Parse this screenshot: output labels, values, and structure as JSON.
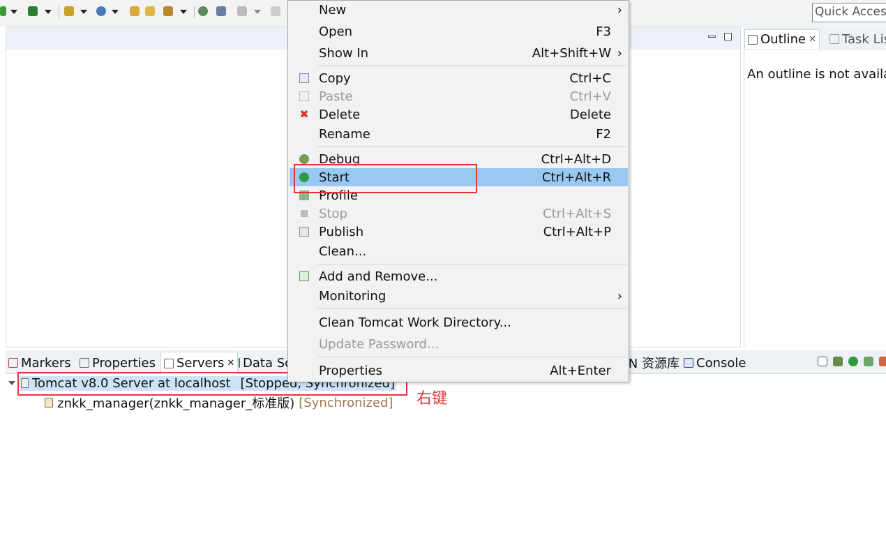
{
  "toolbar": {
    "quick_access": "Quick Access"
  },
  "outline": {
    "tab_outline": "Outline",
    "tab_tasks": "Task List",
    "message": "An outline is not available."
  },
  "bottom_tabs": {
    "markers": "Markers",
    "properties": "Properties",
    "servers": "Servers",
    "data_source": "Data Source Explorer",
    "svn": "SVN 资源库",
    "console": "Console"
  },
  "servers": {
    "server_name": "Tomcat v8.0 Server at localhost",
    "server_status": "[Stopped, Synchronized]",
    "module_name": "znkk_manager(znkk_manager_标准版)",
    "module_status": "[Synchronized]"
  },
  "annotation": {
    "text": "右键",
    "color": "#e5333a"
  },
  "menu": {
    "items": [
      {
        "label": "New",
        "shortcut": "",
        "submenu": true
      },
      {
        "label": "Open",
        "shortcut": "F3"
      },
      {
        "label": "Show In",
        "shortcut": "Alt+Shift+W",
        "submenu": true
      },
      {
        "label": "Copy",
        "shortcut": "Ctrl+C",
        "icon": "copy-icon"
      },
      {
        "label": "Paste",
        "shortcut": "Ctrl+V",
        "icon": "paste-icon",
        "disabled": true
      },
      {
        "label": "Delete",
        "shortcut": "Delete",
        "icon": "delete-icon"
      },
      {
        "label": "Rename",
        "shortcut": "F2"
      },
      {
        "label": "Debug",
        "shortcut": "Ctrl+Alt+D",
        "icon": "debug-icon"
      },
      {
        "label": "Start",
        "shortcut": "Ctrl+Alt+R",
        "icon": "start-icon",
        "selected": true
      },
      {
        "label": "Profile",
        "shortcut": "",
        "icon": "profile-icon"
      },
      {
        "label": "Stop",
        "shortcut": "Ctrl+Alt+S",
        "icon": "stop-icon",
        "disabled": true
      },
      {
        "label": "Publish",
        "shortcut": "Ctrl+Alt+P",
        "icon": "publish-icon"
      },
      {
        "label": "Clean...",
        "shortcut": ""
      },
      {
        "label": "Add and Remove...",
        "shortcut": "",
        "icon": "add-remove-icon"
      },
      {
        "label": "Monitoring",
        "shortcut": "",
        "submenu": true
      },
      {
        "label": "Clean Tomcat Work Directory...",
        "shortcut": ""
      },
      {
        "label": "Update Password...",
        "shortcut": "",
        "disabled": true
      },
      {
        "label": "Properties",
        "shortcut": "Alt+Enter"
      }
    ],
    "colors": {
      "selected_bg": "#99c9f3",
      "disabled_text": "#9a9a9a"
    }
  }
}
